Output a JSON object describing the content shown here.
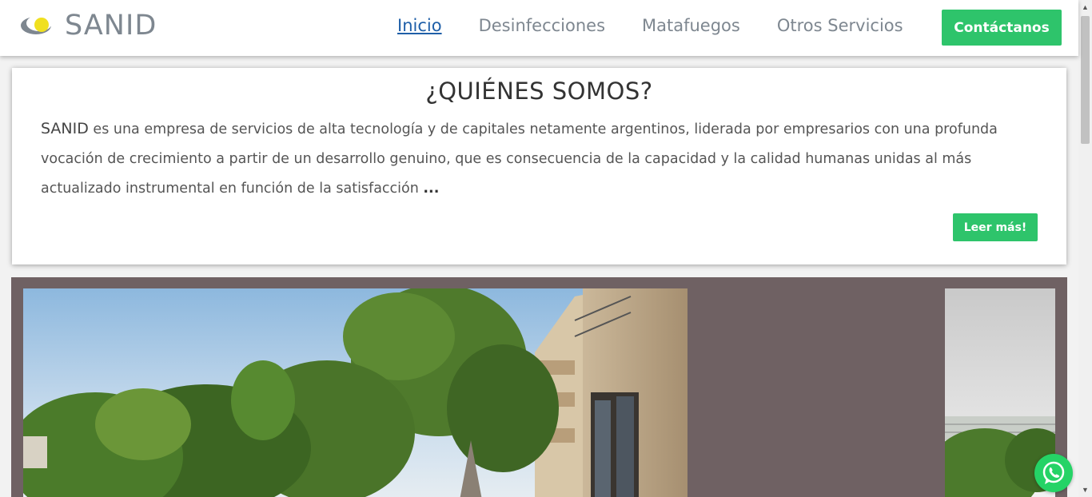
{
  "brand": {
    "name": "SANID",
    "accent_color": "#2ec46b",
    "logo_colors": [
      "#7e8790",
      "#f0e020"
    ]
  },
  "nav": {
    "items": [
      {
        "label": "Inicio",
        "active": true
      },
      {
        "label": "Desinfecciones",
        "active": false
      },
      {
        "label": "Matafuegos",
        "active": false
      },
      {
        "label": "Otros Servicios",
        "active": false
      }
    ],
    "contact_label": "Contáctanos"
  },
  "about": {
    "title": "¿QUIÉNES SOMOS?",
    "company": "SANID",
    "text": " es una empresa de servicios de alta tecnología y de capitales netamente argentinos, liderada por empresarios con una profunda vocación de crecimiento a partir de un desarrollo genuino, que es consecuencia de la capacidad y la calidad humanas unidas al más actualizado instrumental en función de la satisfacción ",
    "ellipsis": "...",
    "read_more_label": "Leer más!"
  },
  "gallery": {
    "background_color": "#6f6163",
    "images": [
      "building-garden-photo",
      "building-photo-partial"
    ]
  },
  "floating": {
    "whatsapp_icon": "whatsapp-icon"
  }
}
